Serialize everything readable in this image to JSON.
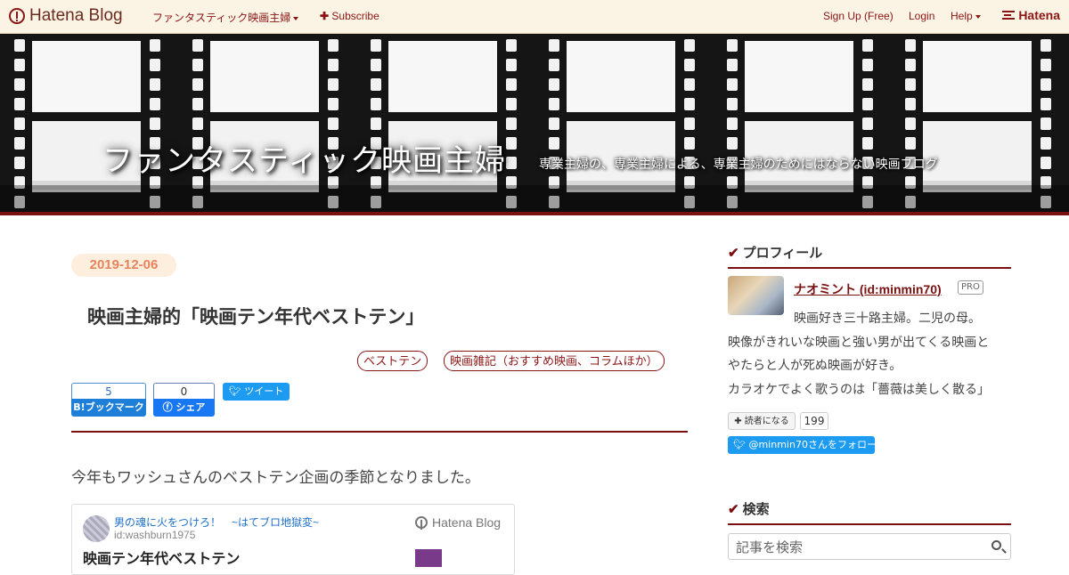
{
  "topbar": {
    "logo_text": "Hatena Blog",
    "blog_menu": "ファンタスティック映画主婦",
    "subscribe": "Subscribe",
    "signup": "Sign Up (Free)",
    "login": "Login",
    "help": "Help",
    "brand": "Hatena"
  },
  "header": {
    "title": "ファンタスティック映画主婦",
    "description": "専業主婦の、専業主婦による、専業主婦のためにはならない映画ブログ"
  },
  "entry": {
    "date": "2019-12-06",
    "title": "映画主婦的「映画テン年代ベストテン」",
    "tags": [
      "ベストテン",
      "映画雑記（おすすめ映画、コラムほか）"
    ],
    "bookmark_count": "5",
    "bookmark_label": "B!ブックマーク",
    "facebook_count": "0",
    "facebook_label": "シェア",
    "tweet_label": "ツイート",
    "first_paragraph": "今年もワッシュさんのベストテン企画の季節となりました。",
    "embed": {
      "blog_name": "男の魂に火をつけろ！　~はてブロ地獄変~",
      "blog_id": "id:washburn1975",
      "brand": "Hatena Blog",
      "title": "映画テン年代ベストテン"
    }
  },
  "sidebar": {
    "profile_heading": "プロフィール",
    "profile_name": "ナオミント (id:minmin70)",
    "pro_badge": "PRO",
    "profile_lines": [
      "映画好き三十路主婦。二児の母。",
      "映像がきれいな映画と強い男が出てくる映画と",
      "やたらと人が死ぬ映画が好き。",
      "カラオケでよく歌うのは「薔薇は美しく散る」"
    ],
    "reader_label": "読者になる",
    "reader_count": "199",
    "follow_label": "@minmin70さんをフォロー",
    "search_heading": "検索",
    "search_placeholder": "記事を検索"
  },
  "icons": {
    "check": "check-icon",
    "plus": "plus-icon",
    "search": "search-icon",
    "twitter": "twitter-icon",
    "facebook": "facebook-icon"
  },
  "colors": {
    "accent": "#7a1010",
    "topbar_bg": "#fbf3e4",
    "date_bg": "#fdeedd",
    "date_text": "#e8845c",
    "twitter": "#1d9bf0"
  }
}
